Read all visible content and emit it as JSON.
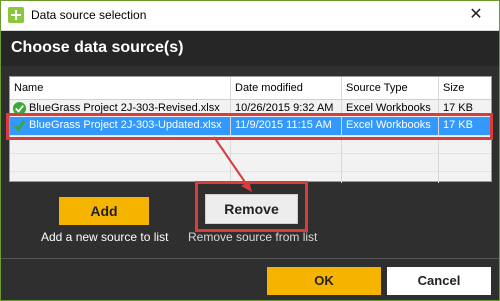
{
  "window": {
    "title": "Data source selection",
    "close_glyph": "✕",
    "icon": "plus-icon"
  },
  "header": {
    "title": "Choose data source(s)"
  },
  "table": {
    "columns": [
      "Name",
      "Date modified",
      "Source Type",
      "Size"
    ],
    "rows": [
      {
        "name": "BlueGrass Project 2J-303-Revised.xlsx",
        "date": "10/26/2015 9:32 AM",
        "type": "Excel Workbooks",
        "size": "17 KB",
        "selected": false,
        "icon": "check-icon"
      },
      {
        "name": "BlueGrass Project 2J-303-Updated.xlsx",
        "date": "11/9/2015 11:15 AM",
        "type": "Excel Workbooks",
        "size": "17 KB",
        "selected": true,
        "icon": "check-icon"
      }
    ]
  },
  "actions": {
    "add_label": "Add",
    "add_caption": "Add a new source to list",
    "remove_label": "Remove",
    "remove_caption": "Remove source from list"
  },
  "footer": {
    "ok_label": "OK",
    "cancel_label": "Cancel"
  },
  "colors": {
    "accent": "#f5b400",
    "selection": "#3399ff",
    "highlight": "#d83c3c",
    "check": "#3aa935",
    "border": "#6c9a2c"
  }
}
